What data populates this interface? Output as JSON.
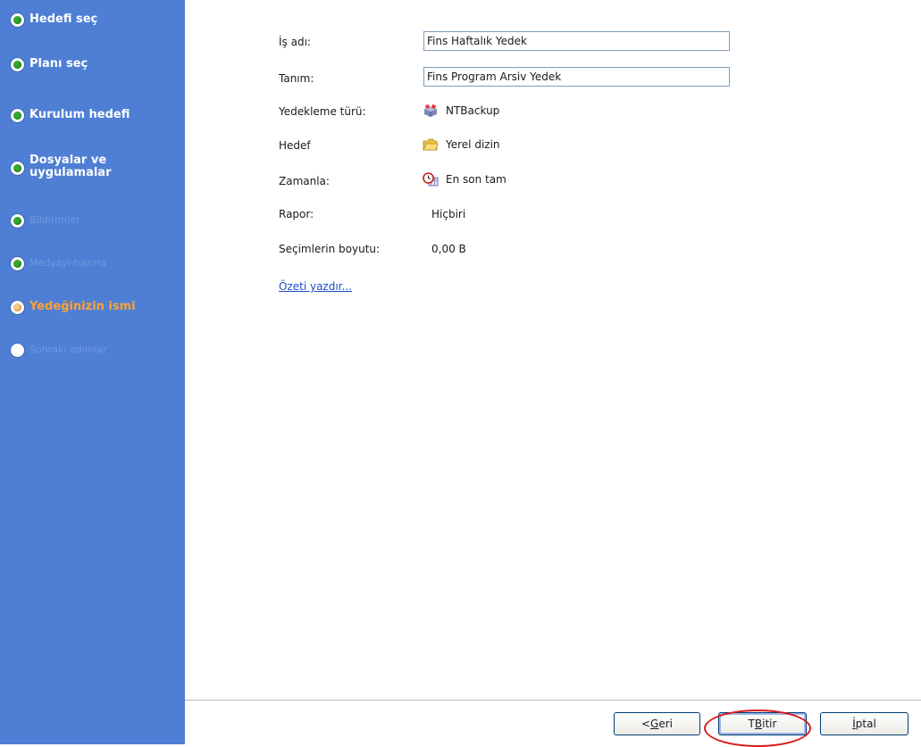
{
  "wizard_steps": [
    {
      "label": "Hedefi seç",
      "state": "done"
    },
    {
      "label": "Planı seç",
      "state": "done"
    },
    {
      "label": "Kurulum hedefi",
      "state": "done"
    },
    {
      "label": "Dosyalar ve\nuygulamalar",
      "state": "done"
    },
    {
      "label": "Bildirimler",
      "state": "dim-done"
    },
    {
      "label": "Medyayı hazırla",
      "state": "dim-done"
    },
    {
      "label": "Yedeğinizin ismi",
      "state": "current"
    },
    {
      "label": "Sonraki adımlar",
      "state": "future"
    }
  ],
  "form": {
    "job_name_label": "İş adı:",
    "job_name_value": "Fins Haftalık Yedek",
    "description_label": "Tanım:",
    "description_value": "Fins Program Arsiv Yedek",
    "backup_type_label": "Yedekleme türü:",
    "backup_type_value": "NTBackup",
    "backup_type_icon": "ntbackup-icon",
    "target_label": "Hedef",
    "target_value": "Yerel dizin",
    "target_icon": "folder-icon",
    "schedule_label": "Zamanla:",
    "schedule_value": "En son tam",
    "schedule_icon": "schedule-clock-icon",
    "report_label": "Rapor:",
    "report_value": "Hiçbiri",
    "size_label": "Seçimlerin boyutu:",
    "size_value": "0,00 B",
    "print_summary_link": "Özeti yazdır..."
  },
  "buttons": {
    "back_prefix": "<",
    "back_mnemonic": "G",
    "back_rest": "eri",
    "finish_prefix": "T",
    "finish_mnemonic": "B",
    "finish_rest": "itir",
    "cancel_mnemonic": "İ",
    "cancel_rest": "ptal"
  },
  "colors": {
    "sidebar_bg": "#4e7fd4",
    "current_step": "#ffa237",
    "annotation": "#d81c1c"
  }
}
